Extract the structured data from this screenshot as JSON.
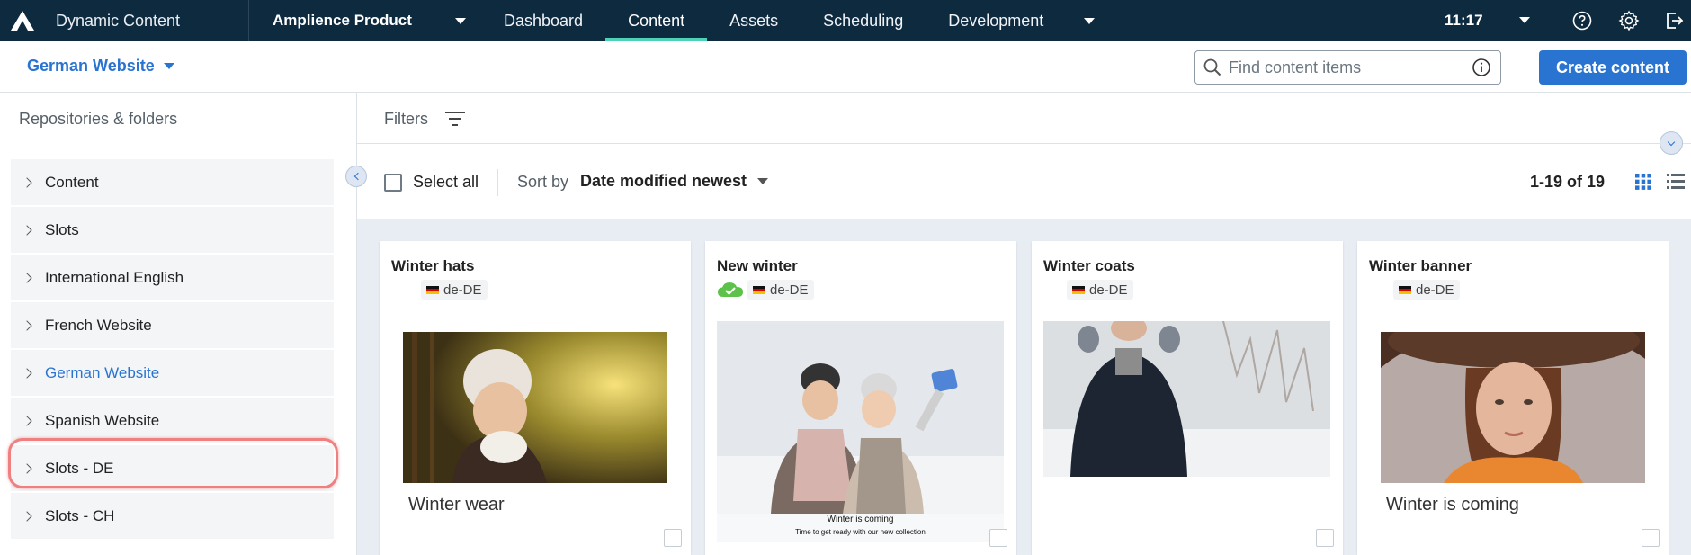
{
  "app": {
    "title": "Dynamic Content"
  },
  "topnav": {
    "product": "Amplience Product",
    "tabs": [
      "Dashboard",
      "Content",
      "Assets",
      "Scheduling",
      "Development"
    ],
    "active_tab": "Content",
    "time": "11:17"
  },
  "subheader": {
    "site": "German Website",
    "search_placeholder": "Find content items",
    "create_label": "Create content"
  },
  "sidebar": {
    "heading": "Repositories & folders",
    "items": [
      {
        "label": "Content"
      },
      {
        "label": "Slots"
      },
      {
        "label": "International English"
      },
      {
        "label": "French Website"
      },
      {
        "label": "German Website"
      },
      {
        "label": "Spanish Website"
      },
      {
        "label": "Slots - DE"
      },
      {
        "label": "Slots - CH"
      }
    ],
    "selected": "German Website"
  },
  "filters": {
    "label": "Filters"
  },
  "toolbar": {
    "select_all": "Select all",
    "sort_by": "Sort by",
    "sort_value": "Date modified newest",
    "count": "1-19 of 19"
  },
  "cards": [
    {
      "title": "Winter hats",
      "locale": "de-DE",
      "caption": "Winter wear",
      "synced": false
    },
    {
      "title": "New winter",
      "locale": "de-DE",
      "caption_line1": "Winter is coming",
      "caption_line2": "Time to get ready with our new collection",
      "synced": true
    },
    {
      "title": "Winter coats",
      "locale": "de-DE",
      "synced": false
    },
    {
      "title": "Winter banner",
      "locale": "de-DE",
      "caption": "Winter is coming",
      "synced": false
    }
  ],
  "colors": {
    "nav_bg": "#0e2a3f",
    "accent": "#2a74d1",
    "active_tab_underline": "#4fd1b8",
    "highlight": "#f08080"
  }
}
